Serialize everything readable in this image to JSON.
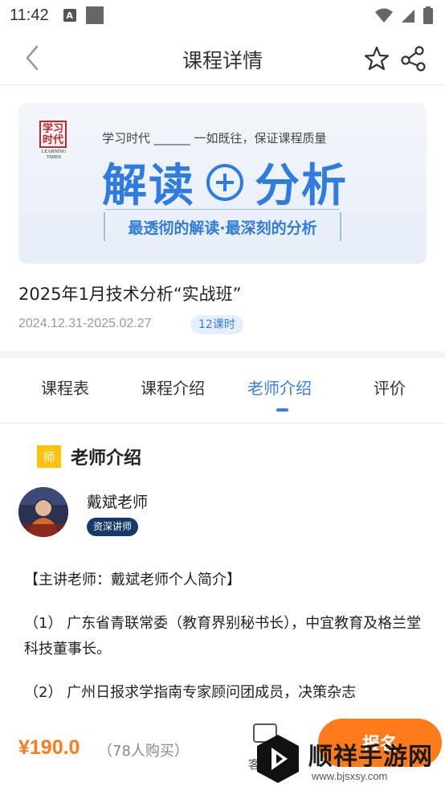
{
  "status_bar": {
    "time": "11:42",
    "a_icon": "A",
    "icons": [
      "wifi-icon",
      "signal-icon",
      "battery-icon"
    ]
  },
  "header": {
    "title": "课程详情",
    "icons": [
      "back-icon",
      "star-icon",
      "share-icon"
    ]
  },
  "banner": {
    "logo_cn": "学习时代",
    "logo_en": "LEARNING TIMES",
    "subtitle": "学习时代 ______ 一如既往，保证课程质量",
    "word_left": "解读",
    "word_right": "分析",
    "tagline": "最透彻的解读·最深刻的分析"
  },
  "course": {
    "title": "2025年1月技术分析“实战班”",
    "dates": "2024.12.31-2025.02.27",
    "hours": "12课时"
  },
  "tabs": [
    {
      "label": "课程表",
      "active": false
    },
    {
      "label": "课程介绍",
      "active": false
    },
    {
      "label": "老师介绍",
      "active": true
    },
    {
      "label": "评价",
      "active": false
    }
  ],
  "teacher_section": {
    "icon_char": "师",
    "title": "老师介绍",
    "name": "戴斌老师",
    "badge": "资深讲师",
    "intro": [
      "【主讲老师：戴斌老师个人简介】",
      "（1） 广东省青联常委（教育界别秘书长），中宜教育及格兰堂科技董事长。",
      "（2） 广州日报求学指南专家顾问团成员，决策杂志"
    ]
  },
  "bottom_bar": {
    "price": "¥190.0",
    "buyers": "（78人购买）",
    "service_label": "客服",
    "enroll_label": "报名"
  },
  "watermark": {
    "text": "顺祥手游网",
    "url": "www.bjsxsy.com"
  },
  "colors": {
    "accent_blue": "#3b7be8",
    "price_orange": "#ff7a1a",
    "badge_yellow": "#ffc20e",
    "teacher_badge_bg": "#163a6a"
  }
}
